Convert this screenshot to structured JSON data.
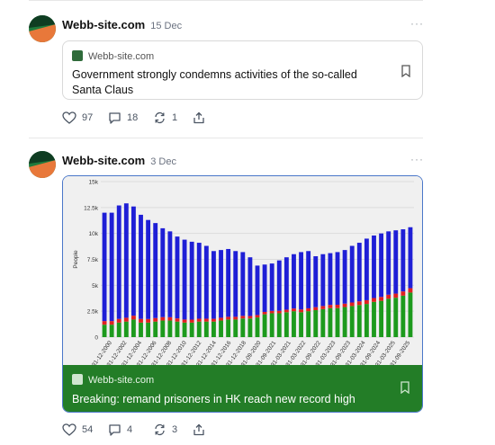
{
  "posts": [
    {
      "author": "Webb-site.com",
      "date": "15 Dec",
      "more": "···",
      "card": {
        "source": "Webb-site.com",
        "title": "Government strongly condemns activities of the so-called Santa Claus"
      },
      "likes": "97",
      "replies": "18",
      "reposts": "1"
    },
    {
      "author": "Webb-site.com",
      "date": "3 Dec",
      "more": "···",
      "card": {
        "source": "Webb-site.com",
        "title": "Breaking: remand prisoners in HK reach new record high"
      },
      "likes": "54",
      "replies": "4",
      "reposts": "3"
    }
  ],
  "colors": {
    "accent_green": "#237d27",
    "link_blue": "#4a77c9",
    "series_total": "#1f1fd6",
    "series_mid": "#e02020",
    "series_base": "#1d9a1d"
  },
  "icons": [
    "heart-icon",
    "reply-icon",
    "repost-icon",
    "share-icon",
    "bookmark-icon",
    "favicon-icon"
  ],
  "chart_data": {
    "type": "bar",
    "ylabel": "People",
    "ylim": [
      0,
      15000
    ],
    "yticks": [
      "0",
      "2.5k",
      "5k",
      "7.5k",
      "10k",
      "12.5k",
      "15k"
    ],
    "ytick_values": [
      0,
      2500,
      5000,
      7500,
      10000,
      12500,
      15000
    ],
    "xtick_labels": [
      "31-12-2000",
      "31-12-2002",
      "31-12-2004",
      "31-12-2006",
      "31-12-2008",
      "31-12-2010",
      "31-12-2012",
      "31-12-2014",
      "31-12-2016",
      "31-12-2018",
      "31-09-2020",
      "31-09-2021",
      "31-03-2021",
      "31-03-2022",
      "31-09-2022",
      "31-03-2023",
      "31-09-2023",
      "31-03-2024",
      "31-09-2024",
      "31-03-2025",
      "31-09-2025"
    ],
    "series": [
      {
        "values": [
          12000,
          12000,
          12700,
          12900,
          12600,
          11800,
          11300,
          11000,
          10500,
          10200,
          9700,
          9400,
          9200,
          9100,
          8800,
          8300,
          8400,
          8500,
          8300,
          8200,
          7700,
          6900,
          7000,
          7100,
          7400,
          7700,
          8000,
          8200,
          8300,
          7800,
          8000,
          8100,
          8200,
          8400,
          8800,
          9100,
          9500,
          9800,
          10000,
          10200,
          10300,
          10400,
          10600
        ]
      },
      {
        "values": [
          350,
          350,
          360,
          370,
          370,
          360,
          350,
          340,
          330,
          320,
          310,
          300,
          290,
          280,
          280,
          270,
          270,
          260,
          260,
          250,
          240,
          230,
          230,
          230,
          240,
          250,
          260,
          270,
          280,
          290,
          300,
          310,
          320,
          330,
          340,
          350,
          360,
          370,
          380,
          390,
          400,
          410,
          420
        ]
      },
      {
        "values": [
          1200,
          1200,
          1400,
          1500,
          1700,
          1400,
          1400,
          1500,
          1600,
          1600,
          1500,
          1400,
          1400,
          1500,
          1500,
          1500,
          1600,
          1700,
          1700,
          1800,
          1800,
          1900,
          2200,
          2300,
          2300,
          2400,
          2500,
          2400,
          2500,
          2600,
          2700,
          2800,
          2800,
          2900,
          3000,
          3100,
          3200,
          3400,
          3500,
          3700,
          3800,
          4000,
          4300
        ]
      }
    ]
  }
}
